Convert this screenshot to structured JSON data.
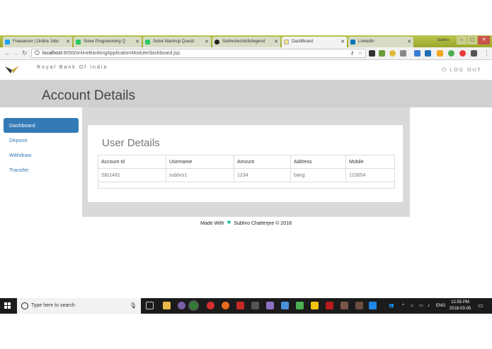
{
  "browser": {
    "tabs": [
      {
        "label": "Freelancer | Online Jobs",
        "color": "#1da1f2"
      },
      {
        "label": "Solve Programming Q",
        "color": "#2ec866"
      },
      {
        "label": "Solve Warmup Questi",
        "color": "#2ec866"
      },
      {
        "label": "Subhrotechinfo/legend",
        "color": "#222222"
      },
      {
        "label": "DashBoard",
        "color": "#f0e68c"
      },
      {
        "label": "LinkedIn",
        "color": "#0077b5"
      }
    ],
    "profile": "Subhro",
    "url_host": "localhost",
    "url_path": ":8050/onlineBankingApplicationModule/dashboard.jsp"
  },
  "app": {
    "brand": "Royal Bank Of India",
    "logout": "LOG OUT",
    "page_title": "Account Details",
    "sidebar": [
      {
        "label": "Dashboard",
        "active": true
      },
      {
        "label": "Deposit",
        "active": false
      },
      {
        "label": "Withdraw",
        "active": false
      },
      {
        "label": "Transfer",
        "active": false
      }
    ],
    "card_title": "User Details",
    "table": {
      "headers": [
        "Account Id",
        "Username",
        "Amount",
        "Address",
        "Mobile"
      ],
      "rows": [
        [
          "SBI1481",
          "subhro1",
          "1234",
          "bang",
          "123654"
        ]
      ]
    },
    "footer": {
      "prefix": "Made With",
      "suffix": "Subhro Chatterjee © 2018"
    }
  },
  "taskbar": {
    "search_placeholder": "Type here to search",
    "lang": "ENG",
    "time": "12:55 PM",
    "date": "2018-03-05"
  },
  "colors": {
    "accent": "#337ab7",
    "heart": "#1abc9c",
    "tabstrip": "#a7b33a"
  }
}
